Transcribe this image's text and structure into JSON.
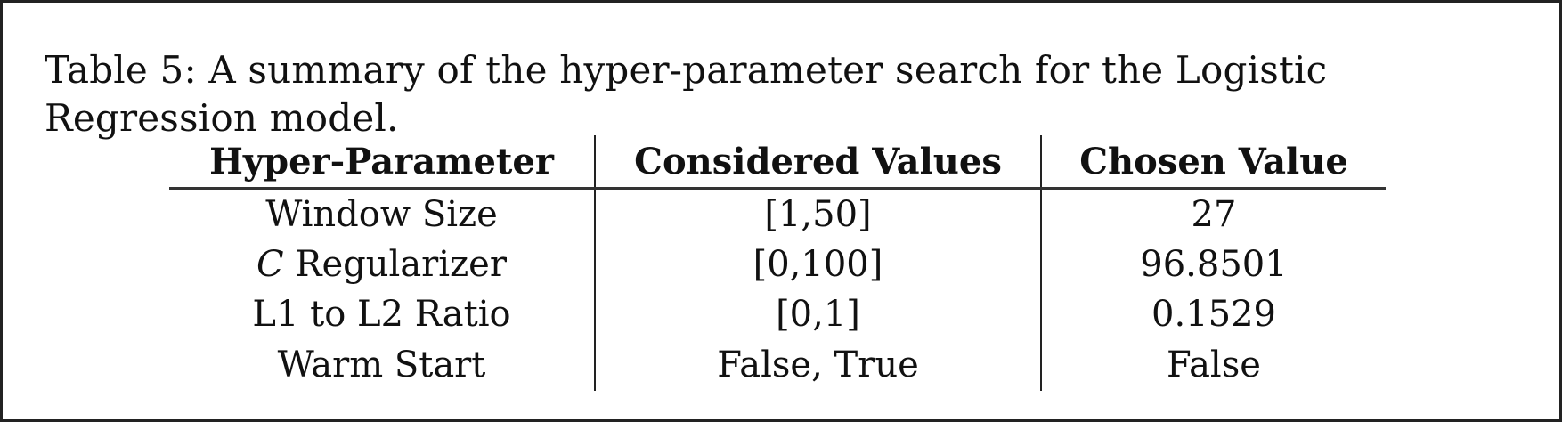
{
  "caption": {
    "text": "Table 5: A summary of the hyper-parameter search for the Logistic Regression model."
  },
  "table": {
    "headers": [
      "Hyper-Parameter",
      "Considered Values",
      "Chosen Value"
    ],
    "rows": [
      {
        "param_prefix": "",
        "param": "Window Size",
        "considered": "[1,50]",
        "chosen": "27"
      },
      {
        "param_prefix": "C",
        "param": " Regularizer",
        "considered": "[0,100]",
        "chosen": "96.8501"
      },
      {
        "param_prefix": "",
        "param": "L1 to L2 Ratio",
        "considered": "[0,1]",
        "chosen": "0.1529"
      },
      {
        "param_prefix": "",
        "param": "Warm Start",
        "considered": "False, True",
        "chosen": "False"
      }
    ]
  }
}
